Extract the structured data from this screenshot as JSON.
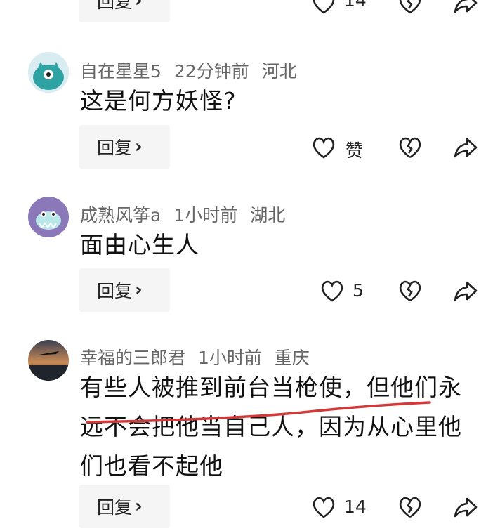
{
  "top_partial": {
    "reply_label": "回复",
    "like_count": "14"
  },
  "comments": [
    {
      "username": "自在星星5",
      "time": "22分钟前",
      "location": "河北",
      "text": "这是何方妖怪?",
      "reply_label": "回复",
      "like_label": "赞",
      "avatar_icon": "teal-monster-avatar"
    },
    {
      "username": "成熟风筝a",
      "time": "1小时前",
      "location": "湖北",
      "text": "面由心生人",
      "reply_label": "回复",
      "like_label": "5",
      "avatar_icon": "purple-monster-avatar"
    },
    {
      "username": "幸福的三郎君",
      "time": "1小时前",
      "location": "重庆",
      "text_lines": [
        "有些人被推到前台当枪使，但他们永",
        "远不会把他当自己人，因为从心里他",
        "们也看不起他"
      ],
      "reply_label": "回复",
      "like_label": "14",
      "avatar_icon": "sunset-avatar"
    }
  ],
  "colors": {
    "annotation_line": "#d23a3a",
    "reply_bg": "#f5f5f5",
    "meta_text": "#666666"
  }
}
